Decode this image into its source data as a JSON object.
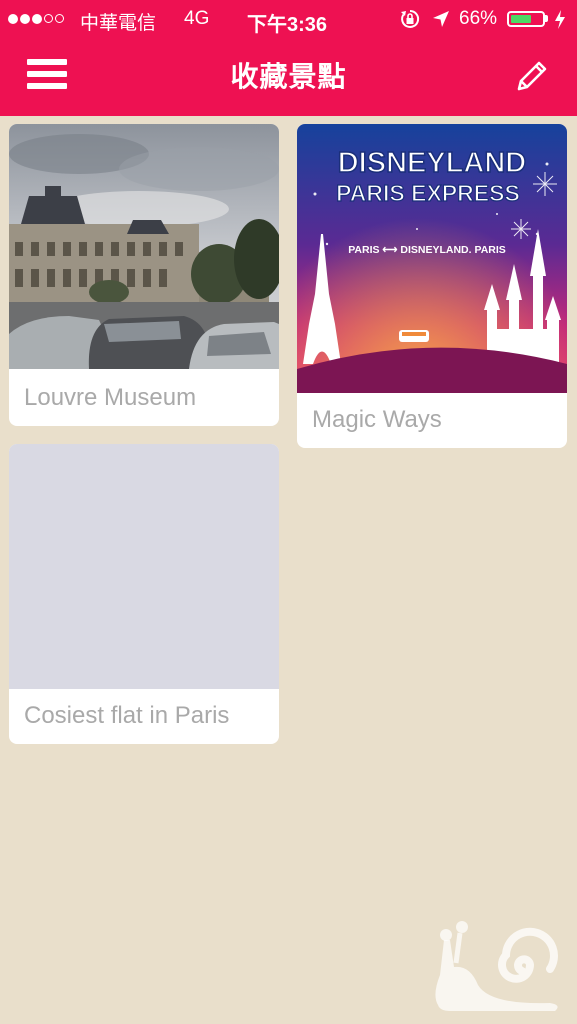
{
  "status_bar": {
    "carrier": "中華電信",
    "network": "4G",
    "time": "下午3:36",
    "battery_percent": "66%",
    "battery_level": 0.66,
    "signal_bars_filled": 3,
    "signal_bars_total": 5,
    "icons": [
      "orientation-lock-icon",
      "location-arrow-icon",
      "battery-icon",
      "charging-bolt-icon"
    ]
  },
  "nav": {
    "title": "收藏景點",
    "menu_icon": "hamburger-menu-icon",
    "edit_icon": "pencil-icon"
  },
  "cards": [
    {
      "title": "Louvre Museum",
      "image": "louvre-museum-photo"
    },
    {
      "title": "Magic Ways",
      "image": "disneyland-paris-express-poster",
      "poster": {
        "line1": "DISNEYLAND",
        "line2": "PARIS EXPRESS",
        "route": "PARIS ⟷ DISNEYLAND. PARIS"
      }
    },
    {
      "title": "Cosiest flat in Paris",
      "image": "placeholder"
    }
  ],
  "colors": {
    "accent": "#ee1152",
    "background": "#e9dfcb",
    "card_label": "#a9a9a9",
    "placeholder": "#d9d9e3"
  }
}
